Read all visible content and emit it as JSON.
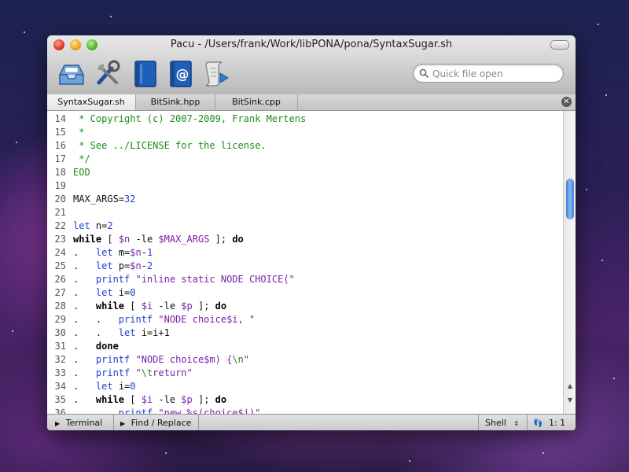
{
  "window": {
    "title": "Pacu - /Users/frank/Work/libPONA/pona/SyntaxSugar.sh"
  },
  "toolbar": {
    "icons": [
      "inbox-tray-icon",
      "tools-icon",
      "book-icon",
      "address-book-icon",
      "script-run-icon"
    ]
  },
  "search": {
    "placeholder": "Quick file open"
  },
  "tabs": [
    {
      "label": "SyntaxSugar.sh",
      "active": true
    },
    {
      "label": "BitSink.hpp",
      "active": false
    },
    {
      "label": "BitSink.cpp",
      "active": false
    }
  ],
  "editor": {
    "lines": [
      {
        "n": "14",
        "t": [
          [
            "c-com",
            " * Copyright (c) 2007-2009, Frank Mertens"
          ]
        ]
      },
      {
        "n": "15",
        "t": [
          [
            "c-com",
            " *"
          ]
        ]
      },
      {
        "n": "16",
        "t": [
          [
            "c-com",
            " * See ../LICENSE for the license."
          ]
        ]
      },
      {
        "n": "17",
        "t": [
          [
            "c-com",
            " */"
          ]
        ]
      },
      {
        "n": "18",
        "t": [
          [
            "c-com",
            "EOD"
          ]
        ]
      },
      {
        "n": "19",
        "t": []
      },
      {
        "n": "20",
        "t": [
          [
            "",
            "MAX_ARGS="
          ],
          [
            "c-num",
            "32"
          ]
        ]
      },
      {
        "n": "21",
        "t": []
      },
      {
        "n": "22",
        "t": [
          [
            "c-blue",
            "let"
          ],
          [
            "",
            " n="
          ],
          [
            "c-num",
            "2"
          ]
        ]
      },
      {
        "n": "23",
        "t": [
          [
            "c-kw",
            "while"
          ],
          [
            "",
            " [ "
          ],
          [
            "c-var",
            "$n"
          ],
          [
            "",
            " -le "
          ],
          [
            "c-var",
            "$MAX_ARGS"
          ],
          [
            "",
            " ]; "
          ],
          [
            "c-kw",
            "do"
          ]
        ]
      },
      {
        "n": "24",
        "t": [
          [
            "",
            ".   "
          ],
          [
            "c-blue",
            "let"
          ],
          [
            "",
            " m="
          ],
          [
            "c-var",
            "$n"
          ],
          [
            "",
            "-"
          ],
          [
            "c-num",
            "1"
          ]
        ]
      },
      {
        "n": "25",
        "t": [
          [
            "",
            ".   "
          ],
          [
            "c-blue",
            "let"
          ],
          [
            "",
            " p="
          ],
          [
            "c-var",
            "$n"
          ],
          [
            "",
            "-"
          ],
          [
            "c-num",
            "2"
          ]
        ]
      },
      {
        "n": "26",
        "t": [
          [
            "",
            ".   "
          ],
          [
            "c-blue",
            "printf"
          ],
          [
            "c-str",
            " \"inline static NODE CHOICE(\""
          ]
        ]
      },
      {
        "n": "27",
        "t": [
          [
            "",
            ".   "
          ],
          [
            "c-blue",
            "let"
          ],
          [
            "",
            " i="
          ],
          [
            "c-num",
            "0"
          ]
        ]
      },
      {
        "n": "28",
        "t": [
          [
            "",
            ".   "
          ],
          [
            "c-kw",
            "while"
          ],
          [
            "",
            " [ "
          ],
          [
            "c-var",
            "$i"
          ],
          [
            "",
            " -le "
          ],
          [
            "c-var",
            "$p"
          ],
          [
            "",
            " ]; "
          ],
          [
            "c-kw",
            "do"
          ]
        ]
      },
      {
        "n": "29",
        "t": [
          [
            "",
            ".   .   "
          ],
          [
            "c-blue",
            "printf"
          ],
          [
            "c-str",
            " \"NODE choice"
          ],
          [
            "c-var",
            "$i"
          ],
          [
            "c-str",
            ", \""
          ]
        ]
      },
      {
        "n": "30",
        "t": [
          [
            "",
            ".   .   "
          ],
          [
            "c-blue",
            "let"
          ],
          [
            "",
            " i=i+1"
          ]
        ]
      },
      {
        "n": "31",
        "t": [
          [
            "",
            ".   "
          ],
          [
            "c-kw",
            "done"
          ]
        ]
      },
      {
        "n": "32",
        "t": [
          [
            "",
            ".   "
          ],
          [
            "c-blue",
            "printf"
          ],
          [
            "c-str",
            " \"NODE choice"
          ],
          [
            "c-var",
            "$m"
          ],
          [
            "c-str",
            ") {"
          ],
          [
            "c-esc",
            "\\n"
          ],
          [
            "c-str",
            "\""
          ]
        ]
      },
      {
        "n": "33",
        "t": [
          [
            "",
            ".   "
          ],
          [
            "c-blue",
            "printf"
          ],
          [
            "c-str",
            " \""
          ],
          [
            "c-esc",
            "\\t"
          ],
          [
            "c-str",
            "return\""
          ]
        ]
      },
      {
        "n": "34",
        "t": [
          [
            "",
            ".   "
          ],
          [
            "c-blue",
            "let"
          ],
          [
            "",
            " i="
          ],
          [
            "c-num",
            "0"
          ]
        ]
      },
      {
        "n": "35",
        "t": [
          [
            "",
            ".   "
          ],
          [
            "c-kw",
            "while"
          ],
          [
            "",
            " [ "
          ],
          [
            "c-var",
            "$i"
          ],
          [
            "",
            " -le "
          ],
          [
            "c-var",
            "$p"
          ],
          [
            "",
            " ]; "
          ],
          [
            "c-kw",
            "do"
          ]
        ]
      },
      {
        "n": "36",
        "t": [
          [
            "",
            ".   .   "
          ],
          [
            "c-blue",
            "printf"
          ],
          [
            "c-str",
            " \"new %s(choice"
          ],
          [
            "c-var",
            "$i"
          ],
          [
            "c-str",
            ")\""
          ]
        ]
      }
    ]
  },
  "statusbar": {
    "terminal_label": "Terminal",
    "find_label": "Find / Replace",
    "language": "Shell",
    "cursor": "1: 1"
  }
}
